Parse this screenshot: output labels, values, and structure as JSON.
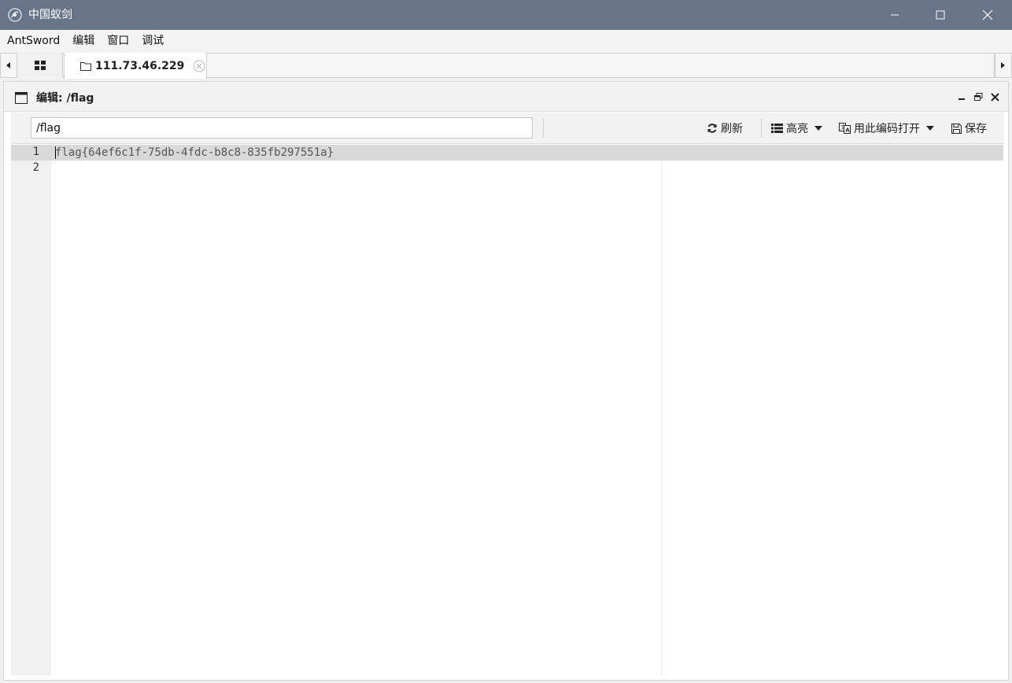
{
  "window": {
    "title": "中国蚁剑",
    "title_bar_color": "#687589"
  },
  "menu": {
    "items": [
      "AntSword",
      "编辑",
      "窗口",
      "调试"
    ]
  },
  "tabs": {
    "active_label": "111.73.46.229"
  },
  "panel": {
    "title": "编辑: /flag"
  },
  "toolbar": {
    "path_value": "/flag",
    "refresh_label": "刷新",
    "highlight_label": "高亮",
    "encoding_label": "用此编码打开",
    "save_label": "保存"
  },
  "editor": {
    "lines": [
      {
        "number": "1",
        "text": "flag{64ef6c1f-75db-4fdc-b8c8-835fb297551a}"
      },
      {
        "number": "2",
        "text": ""
      }
    ],
    "active_line_color": "#d9d9d9"
  }
}
